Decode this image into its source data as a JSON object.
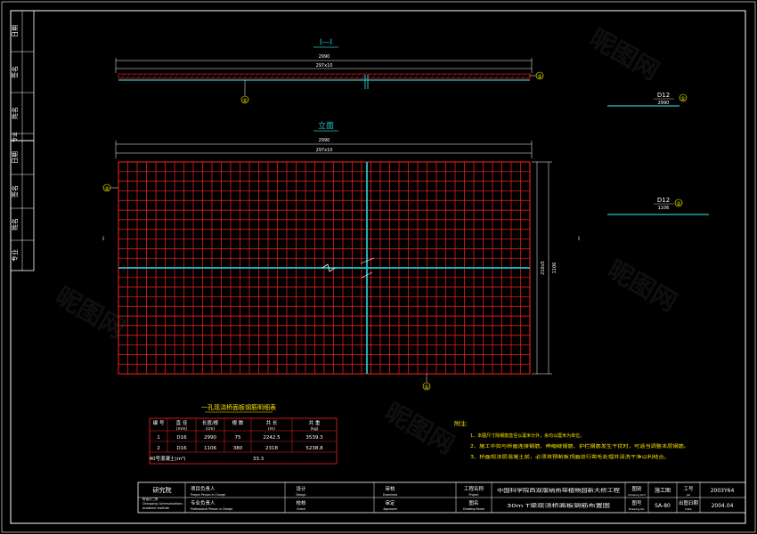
{
  "colors": {
    "background": "#000000",
    "frame": "#ffffff",
    "mesh": "#ff2020",
    "bar": "#27c2c6",
    "table_line": "#ff2020",
    "text": "#ffffff",
    "yellow": "#ffe600",
    "green_note": "#33dd33",
    "circle": "#ffff00"
  },
  "sidebar": {
    "upper": [
      "日期",
      "签名",
      "姓名",
      "专业"
    ],
    "lower": [
      "日期",
      "签名",
      "姓名",
      "专业"
    ]
  },
  "section_view": {
    "title": "I—I",
    "dim_top": "2990",
    "dim_sub": "297x10",
    "marker_1": "①",
    "marker_2": "②"
  },
  "elevation_view": {
    "title": "立面",
    "dim_top": "2990",
    "dim_sub": "297x10",
    "dim_right_a": "210x5",
    "dim_right_b": "1106",
    "marker_1": "①",
    "marker_2": "②",
    "cut_left": "I",
    "cut_right": "I"
  },
  "bar_details": [
    {
      "label": "D12",
      "length": "2990",
      "marker": "①"
    },
    {
      "label": "D12",
      "length": "1106",
      "marker": "②"
    }
  ],
  "rebar_table": {
    "title": "一孔现浇桥面板钢筋明细表",
    "headers": [
      "编 号",
      "直 径",
      "长度/根",
      "根 数",
      "共 长",
      "共 重"
    ],
    "units": [
      "",
      "(mm)",
      "(cm)",
      "",
      "(m)",
      "(kg)"
    ],
    "rows": [
      [
        "1",
        "D16",
        "2990",
        "75",
        "2242.5",
        "3539.3"
      ],
      [
        "2",
        "D16",
        "1106",
        "380",
        "2318",
        "5238.8"
      ]
    ],
    "footer_label": "40号混凝土(m³)",
    "footer_value": "33.3"
  },
  "notes": {
    "title": "附注:",
    "items": [
      "1、本图尺寸除钢筋直径以毫米计外，余均以厘米为单位。",
      "2、施工中如与桥面连接钢筋、伸缩缝钢筋、护栏钢筋发生干扰时，可适当调整本层钢筋。",
      "3、桥面现浇层混凝土前，必须将预制板顶面进行凿毛处理并清洗干净以利结合。"
    ]
  },
  "title_block": {
    "institute": "研究院",
    "row1": {
      "lead_cn": "项目负责人",
      "lead_en": "Project Person in Charge",
      "design": "设计",
      "design_en": "Design",
      "review": "审核",
      "review_en": "Examined",
      "project_name_label": "工程名称",
      "project_name_label_en": "Project",
      "project_name": "中国科学院西双版纳热带植物园新大桥工程",
      "drawing_type_label": "图别",
      "drawing_type_label_en": "Drawing Sort",
      "drawing_type": "施工图",
      "job_no_label": "工号",
      "job_no_label_en": "Job",
      "job_no": "2003Y64"
    },
    "row2": {
      "lead_cn": "专业负责人",
      "lead_en": "Professional Person in Charge",
      "check": "校核",
      "check_en": "Check",
      "approve": "审定",
      "approve_en": "Approved",
      "drawing_name_label": "图名",
      "drawing_name_label_en": "Drawing Name",
      "drawing_name": "30m T梁现浇桥面板钢筋布置图",
      "drawing_no_label": "图号",
      "drawing_no_label_en": "Drawing No.",
      "drawing_no": "SA-80",
      "date_label": "出图日期",
      "date_label_en": "Date",
      "date": "2004.04"
    },
    "left_small_lines": [
      "研究院",
      "所设计二所",
      "Chongqing Communications",
      "Academic Institute"
    ]
  },
  "watermark": "昵图网"
}
